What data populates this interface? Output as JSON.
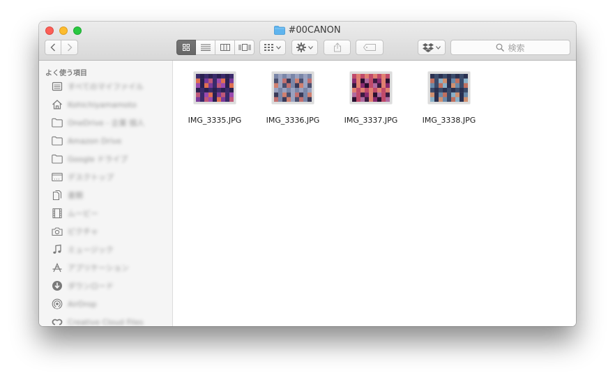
{
  "window": {
    "title": "#00CANON"
  },
  "toolbar": {
    "search_placeholder": "検索"
  },
  "sidebar": {
    "header": "よく使う項目",
    "items": [
      {
        "label": "すべてのマイファイル",
        "icon": "all-files-icon"
      },
      {
        "label": "Kohichiyamamoto",
        "icon": "home-icon"
      },
      {
        "label": "OneDrive - 企業 個人",
        "icon": "folder-icon"
      },
      {
        "label": "Amazon Drive",
        "icon": "folder-icon"
      },
      {
        "label": "Google ドライブ",
        "icon": "folder-icon"
      },
      {
        "label": "デスクトップ",
        "icon": "desktop-icon"
      },
      {
        "label": "書類",
        "icon": "documents-icon"
      },
      {
        "label": "ムービー",
        "icon": "movies-icon"
      },
      {
        "label": "ピクチャ",
        "icon": "camera-icon"
      },
      {
        "label": "ミュージック",
        "icon": "music-icon"
      },
      {
        "label": "アプリケーション",
        "icon": "applications-icon"
      },
      {
        "label": "ダウンロード",
        "icon": "downloads-icon"
      },
      {
        "label": "AirDrop",
        "icon": "airdrop-icon"
      },
      {
        "label": "Creative Cloud Files",
        "icon": "creative-cloud-icon"
      }
    ]
  },
  "files": [
    {
      "name": "IMG_3335.JPG",
      "palette": [
        "#3a2a6a",
        "#7a3a9a",
        "#c05878",
        "#2a2050",
        "#9a4ab0",
        "#e07050"
      ]
    },
    {
      "name": "IMG_3336.JPG",
      "palette": [
        "#4a5070",
        "#7a86a8",
        "#c27070",
        "#3a3a58",
        "#9aa2c0",
        "#d08070"
      ]
    },
    {
      "name": "IMG_3337.JPG",
      "palette": [
        "#3a1a40",
        "#8a2a70",
        "#c04a6a",
        "#2a1030",
        "#b06aa0",
        "#e08070"
      ]
    },
    {
      "name": "IMG_3338.JPG",
      "palette": [
        "#3a4a6a",
        "#6a8aaa",
        "#c07060",
        "#2a3050",
        "#8ab0c8",
        "#d09070"
      ]
    }
  ]
}
